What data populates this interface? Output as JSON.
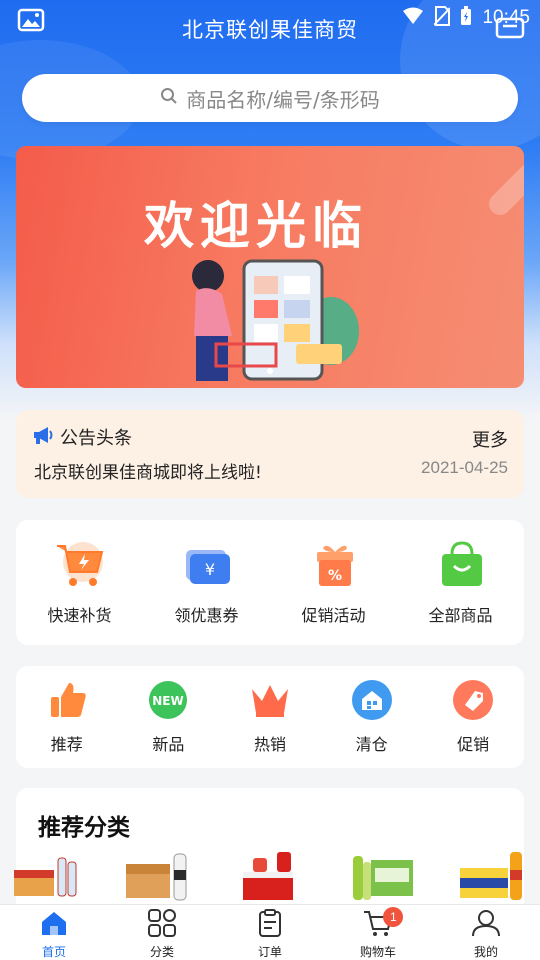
{
  "status": {
    "time": "10:45"
  },
  "app": {
    "title": "北京联创果佳商贸"
  },
  "search": {
    "placeholder": "商品名称/编号/条形码"
  },
  "banner": {
    "title": "欢迎光临"
  },
  "notice": {
    "heading": "公告头条",
    "more": "更多",
    "text": "北京联创果佳商城即将上线啦!",
    "date": "2021-04-25"
  },
  "quick_actions": [
    {
      "label": "快速补货",
      "icon": "cart-bolt-icon"
    },
    {
      "label": "领优惠券",
      "icon": "coupon-icon"
    },
    {
      "label": "促销活动",
      "icon": "gift-percent-icon"
    },
    {
      "label": "全部商品",
      "icon": "shopping-bag-icon"
    }
  ],
  "categories": [
    {
      "label": "推荐",
      "icon": "thumbs-up-icon"
    },
    {
      "label": "新品",
      "icon": "new-badge-icon"
    },
    {
      "label": "热销",
      "icon": "crown-icon"
    },
    {
      "label": "清仓",
      "icon": "warehouse-icon"
    },
    {
      "label": "促销",
      "icon": "tag-icon"
    }
  ],
  "recommend": {
    "title": "推荐分类"
  },
  "tabbar": {
    "items": [
      {
        "label": "首页",
        "icon": "home-icon",
        "active": true
      },
      {
        "label": "分类",
        "icon": "category-grid-icon"
      },
      {
        "label": "订单",
        "icon": "clipboard-icon"
      },
      {
        "label": "购物车",
        "icon": "cart-icon",
        "badge": "1"
      },
      {
        "label": "我的",
        "icon": "user-icon"
      }
    ]
  },
  "colors": {
    "primary": "#1e6ff0",
    "banner": "#f45c4a",
    "badge": "#f0543c"
  }
}
